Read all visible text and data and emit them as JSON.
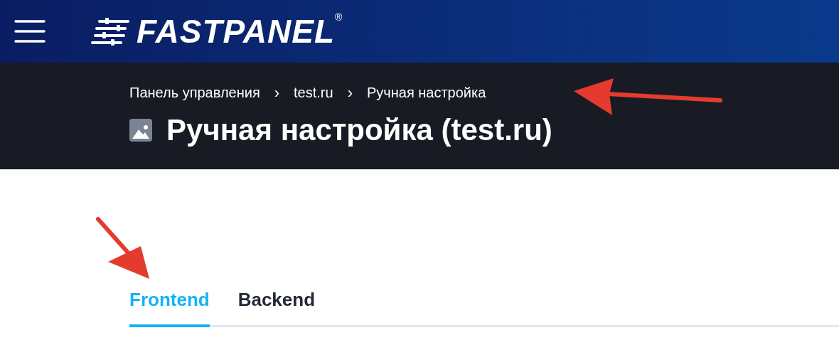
{
  "header": {
    "logo": "FASTPANEL",
    "registered_mark": "®"
  },
  "breadcrumbs": [
    {
      "label": "Панель управления"
    },
    {
      "label": "test.ru"
    },
    {
      "label": "Ручная настройка"
    }
  ],
  "breadcrumb_separator": "›",
  "page_title": "Ручная настройка (test.ru)",
  "tabs": [
    {
      "label": "Frontend",
      "selected": true
    },
    {
      "label": "Backend",
      "selected": false
    }
  ]
}
